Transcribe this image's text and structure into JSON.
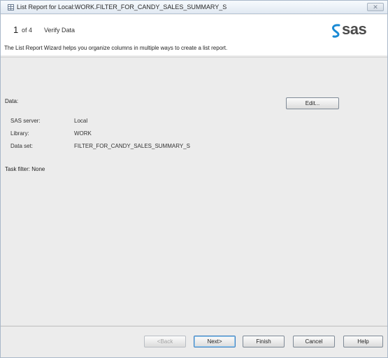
{
  "window": {
    "title": "List Report for Local:WORK.FILTER_FOR_CANDY_SALES_SUMMARY_S",
    "close_glyph": "✕"
  },
  "header": {
    "step_number": "1",
    "step_of": "of 4",
    "step_title": "Verify Data",
    "logo_text": "sas"
  },
  "description": "The List Report Wizard helps you organize columns in multiple ways to create a list report.",
  "data_section": {
    "label": "Data:",
    "edit_label": "Edit...",
    "rows": [
      {
        "label": "SAS server:",
        "value": "Local"
      },
      {
        "label": "Library:",
        "value": "WORK"
      },
      {
        "label": "Data set:",
        "value": "FILTER_FOR_CANDY_SALES_SUMMARY_S"
      }
    ],
    "task_filter": "Task filter: None"
  },
  "footer": {
    "back_label": "<Back",
    "next_label": "Next>",
    "finish_label": "Finish",
    "cancel_label": "Cancel",
    "help_label": "Help"
  },
  "colors": {
    "logo_blue": "#1a8ad4",
    "logo_gray": "#4a4a4a"
  }
}
